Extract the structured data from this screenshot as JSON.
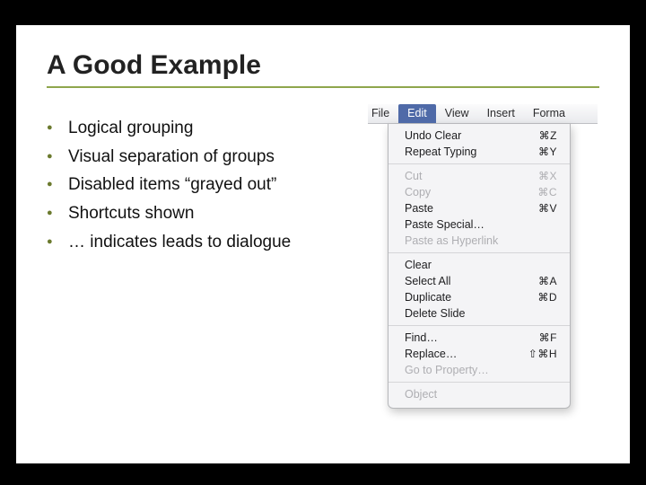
{
  "title": "A Good Example",
  "bullets": [
    "Logical grouping",
    "Visual separation of groups",
    "Disabled items “grayed out”",
    "Shortcuts shown",
    "… indicates leads to dialogue"
  ],
  "menubar": {
    "items": [
      "File",
      "Edit",
      "View",
      "Insert",
      "Forma"
    ],
    "active_index": 1
  },
  "menu": {
    "groups": [
      [
        {
          "label": "Undo Clear",
          "shortcut": "⌘Z",
          "disabled": false
        },
        {
          "label": "Repeat Typing",
          "shortcut": "⌘Y",
          "disabled": false
        }
      ],
      [
        {
          "label": "Cut",
          "shortcut": "⌘X",
          "disabled": true
        },
        {
          "label": "Copy",
          "shortcut": "⌘C",
          "disabled": true
        },
        {
          "label": "Paste",
          "shortcut": "⌘V",
          "disabled": false
        },
        {
          "label": "Paste Special…",
          "shortcut": "",
          "disabled": false
        },
        {
          "label": "Paste as Hyperlink",
          "shortcut": "",
          "disabled": true
        }
      ],
      [
        {
          "label": "Clear",
          "shortcut": "",
          "disabled": false
        },
        {
          "label": "Select All",
          "shortcut": "⌘A",
          "disabled": false
        },
        {
          "label": "Duplicate",
          "shortcut": "⌘D",
          "disabled": false
        },
        {
          "label": "Delete Slide",
          "shortcut": "",
          "disabled": false
        }
      ],
      [
        {
          "label": "Find…",
          "shortcut": "⌘F",
          "disabled": false
        },
        {
          "label": "Replace…",
          "shortcut": "⇧⌘H",
          "disabled": false
        },
        {
          "label": "Go to Property…",
          "shortcut": "",
          "disabled": true
        }
      ],
      [
        {
          "label": "Object",
          "shortcut": "",
          "disabled": true
        }
      ]
    ]
  }
}
